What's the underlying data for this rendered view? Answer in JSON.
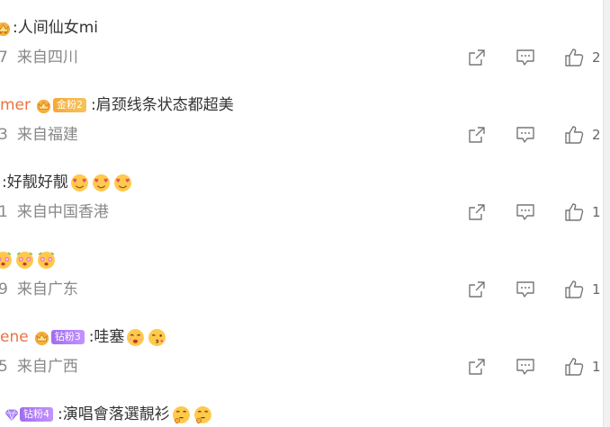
{
  "comments": [
    {
      "username": "",
      "text": ":人间仙女mi",
      "time_fragment": "7",
      "location": "来自四川",
      "likes": "2",
      "badge": ""
    },
    {
      "username": "mer",
      "text": ":肩颈线条状态都超美",
      "time_fragment": "3",
      "location": "来自福建",
      "likes": "2",
      "badge": "金粉2"
    },
    {
      "username": "",
      "text": ":好靓好靓",
      "time_fragment": "1",
      "location": "来自中国香港",
      "likes": "1",
      "badge": ""
    },
    {
      "username": "",
      "text": "",
      "time_fragment": "9",
      "location": "来自广东",
      "likes": "1",
      "badge": ""
    },
    {
      "username": "ene",
      "text": ":哇塞",
      "time_fragment": "5",
      "location": "来自广西",
      "likes": "1",
      "badge": "钻粉3"
    },
    {
      "username": "",
      "text": ":演唱會落選靚衫",
      "badge": "钻粉4"
    }
  ],
  "icons": {
    "share": "share-icon",
    "comment": "comment-icon",
    "like": "thumbs-up-icon",
    "crown": "crown-icon",
    "diamond": "diamond-icon"
  },
  "colors": {
    "username": "#eb7340",
    "meta_text": "#888888",
    "gold_badge": "#f7a833",
    "diamond_badge": "#a06cf0"
  }
}
